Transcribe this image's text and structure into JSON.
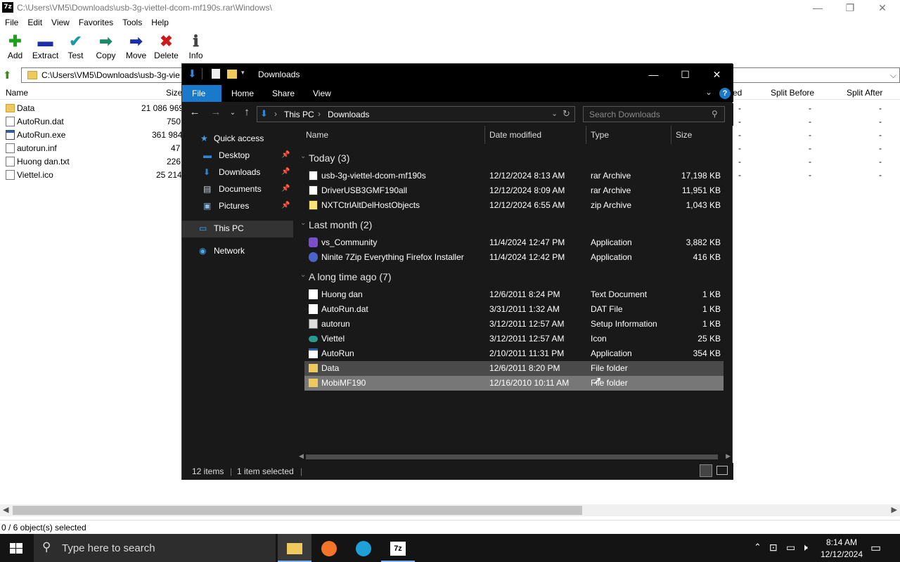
{
  "zip": {
    "title": "C:\\Users\\VM5\\Downloads\\usb-3g-viettel-dcom-mf190s.rar\\Windows\\",
    "app_icon": "7z",
    "menu": [
      "File",
      "Edit",
      "View",
      "Favorites",
      "Tools",
      "Help"
    ],
    "toolbar": [
      {
        "label": "Add",
        "glyph": "✚",
        "color": "#1aa31a",
        "icon": "add-icon"
      },
      {
        "label": "Extract",
        "glyph": "▬",
        "color": "#1a2fa8",
        "icon": "extract-icon"
      },
      {
        "label": "Test",
        "glyph": "✔",
        "color": "#1a9aa8",
        "icon": "test-icon"
      },
      {
        "label": "Copy",
        "glyph": "➡",
        "color": "#1a8a6a",
        "icon": "copy-icon"
      },
      {
        "label": "Move",
        "glyph": "➡",
        "color": "#1a2fa8",
        "icon": "move-icon"
      },
      {
        "label": "Delete",
        "glyph": "✖",
        "color": "#d01818",
        "icon": "delete-icon"
      },
      {
        "label": "Info",
        "glyph": "ℹ",
        "color": "#444",
        "icon": "info-icon"
      }
    ],
    "address": "C:\\Users\\VM5\\Downloads\\usb-3g-vie",
    "columns": {
      "name": "Name",
      "size": "Size",
      "d": "ed",
      "split_before": "Split Before",
      "split_after": "Split After"
    },
    "rows": [
      {
        "name": "Data",
        "size": "21 086 969",
        "icon": "folder",
        "sb": "-",
        "sa": "-",
        "d": "-"
      },
      {
        "name": "AutoRun.dat",
        "size": "750",
        "icon": "doc",
        "sb": "-",
        "sa": "-",
        "d": "-"
      },
      {
        "name": "AutoRun.exe",
        "size": "361 984",
        "icon": "exe",
        "sb": "-",
        "sa": "-",
        "d": "-"
      },
      {
        "name": "autorun.inf",
        "size": "47",
        "icon": "doc",
        "sb": "-",
        "sa": "-",
        "d": "-"
      },
      {
        "name": "Huong dan.txt",
        "size": "226",
        "icon": "doc",
        "sb": "-",
        "sa": "-",
        "d": "-"
      },
      {
        "name": "Viettel.ico",
        "size": "25 214",
        "icon": "doc",
        "sb": "-",
        "sa": "-",
        "d": "-"
      }
    ],
    "status": "0 / 6 object(s) selected"
  },
  "explorer": {
    "title": "Downloads",
    "ribbon_tabs": [
      "File",
      "Home",
      "Share",
      "View"
    ],
    "breadcrumb": [
      "This PC",
      "Downloads"
    ],
    "search_placeholder": "Search Downloads",
    "sidebar": [
      {
        "label": "Quick access",
        "icon": "star-icon",
        "glyph": "★",
        "color": "#4a9ee8",
        "pin": false
      },
      {
        "label": "Desktop",
        "icon": "desktop-icon",
        "glyph": "▬",
        "color": "#2f86d4",
        "pin": true
      },
      {
        "label": "Downloads",
        "icon": "download-icon",
        "glyph": "⬇",
        "color": "#2f86d4",
        "pin": true
      },
      {
        "label": "Documents",
        "icon": "documents-icon",
        "glyph": "▤",
        "color": "#cfd6de",
        "pin": true
      },
      {
        "label": "Pictures",
        "icon": "pictures-icon",
        "glyph": "▣",
        "color": "#8fb6dc",
        "pin": true
      },
      {
        "label": "This PC",
        "icon": "pc-icon",
        "glyph": "▭",
        "color": "#4aa8e8",
        "pin": false
      },
      {
        "label": "Network",
        "icon": "network-icon",
        "glyph": "◉",
        "color": "#4aa8e8",
        "pin": false
      }
    ],
    "columns": {
      "name": "Name",
      "date": "Date modified",
      "type": "Type",
      "size": "Size"
    },
    "groups": [
      {
        "label": "Today (3)",
        "items": [
          {
            "name": "usb-3g-viettel-dcom-mf190s",
            "date": "12/12/2024 8:13 AM",
            "type": "rar Archive",
            "size": "17,198 KB",
            "icon": "archive"
          },
          {
            "name": "DriverUSB3GMF190all",
            "date": "12/12/2024 8:09 AM",
            "type": "rar Archive",
            "size": "11,951 KB",
            "icon": "archive"
          },
          {
            "name": "NXTCtrlAltDelHostObjects",
            "date": "12/12/2024 6:55 AM",
            "type": "zip Archive",
            "size": "1,043 KB",
            "icon": "archive"
          }
        ]
      },
      {
        "label": "Last month (2)",
        "items": [
          {
            "name": "vs_Community",
            "date": "11/4/2024 12:47 PM",
            "type": "Application",
            "size": "3,882 KB",
            "icon": "vs"
          },
          {
            "name": "Ninite 7Zip Everything Firefox Installer",
            "date": "11/4/2024 12:42 PM",
            "type": "Application",
            "size": "416 KB",
            "icon": "ninite"
          }
        ]
      },
      {
        "label": "A long time ago (7)",
        "items": [
          {
            "name": "Huong dan",
            "date": "12/6/2011 8:24 PM",
            "type": "Text Document",
            "size": "1 KB",
            "icon": "doc"
          },
          {
            "name": "AutoRun.dat",
            "date": "3/31/2011 1:32 AM",
            "type": "DAT File",
            "size": "1 KB",
            "icon": "doc"
          },
          {
            "name": "autorun",
            "date": "3/12/2011 12:57 AM",
            "type": "Setup Information",
            "size": "1 KB",
            "icon": "setup"
          },
          {
            "name": "Viettel",
            "date": "3/12/2011 12:57 AM",
            "type": "Icon",
            "size": "25 KB",
            "icon": "viettel"
          },
          {
            "name": "AutoRun",
            "date": "2/10/2011 11:31 PM",
            "type": "Application",
            "size": "354 KB",
            "icon": "exe"
          },
          {
            "name": "Data",
            "date": "12/6/2011 8:20 PM",
            "type": "File folder",
            "size": "",
            "icon": "folder"
          },
          {
            "name": "MobiMF190",
            "date": "12/16/2010 10:11 AM",
            "type": "File folder",
            "size": "",
            "icon": "folder"
          }
        ]
      }
    ],
    "status_items": "12 items",
    "status_selected": "1 item selected"
  },
  "taskbar": {
    "search_placeholder": "Type here to search",
    "time": "8:14 AM",
    "date": "12/12/2024"
  }
}
